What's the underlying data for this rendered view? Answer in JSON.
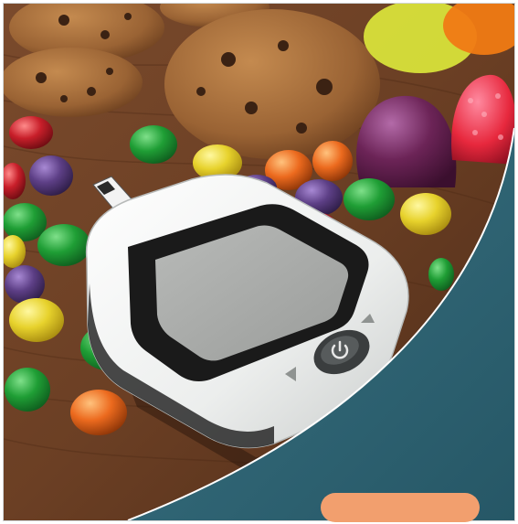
{
  "colors": {
    "table_wood": "#6b3f24",
    "teal_overlay": "#2f6272",
    "cta_pill": "#f29f6e",
    "meter_body": "#f2f3f2",
    "meter_screen": "#a8aaa8",
    "candy_green": "#1f9e35",
    "candy_yellow": "#e7d22c",
    "candy_purple": "#5d3f86",
    "candy_red": "#c81f2a",
    "candy_orange": "#ec6a1e",
    "cookie": "#9a6334"
  },
  "icons": {
    "meter_power": "power-icon",
    "meter_arrow_up": "triangle-up-icon",
    "meter_arrow_left": "triangle-left-icon"
  },
  "cta": {
    "label": ""
  }
}
